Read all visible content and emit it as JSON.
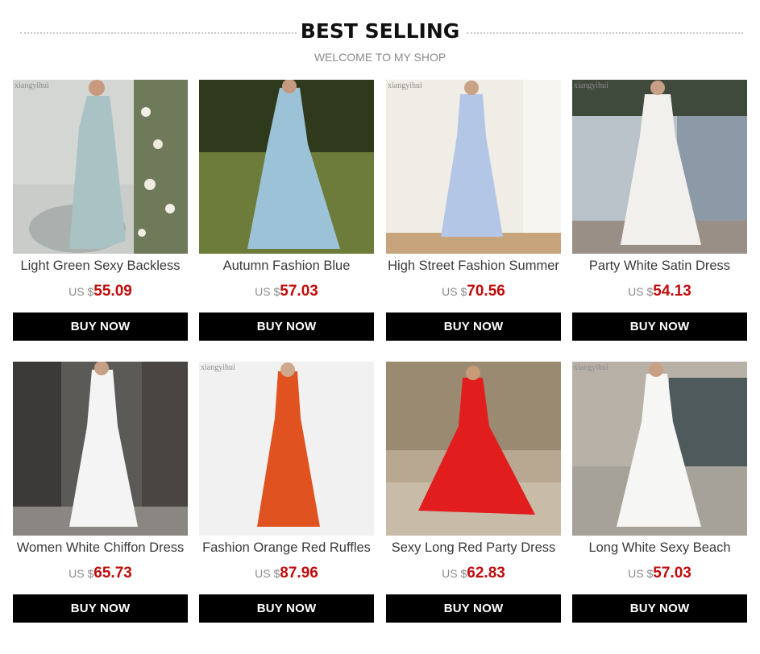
{
  "header": {
    "title": "BEST SELLING",
    "subtitle": "WELCOME TO MY SHOP"
  },
  "products": [
    {
      "name": "Light Green Sexy Backless",
      "currency": "US $",
      "price": "55.09",
      "button": "BUY NOW",
      "watermark": "xiangyihui"
    },
    {
      "name": "Autumn Fashion Blue",
      "currency": "US $",
      "price": "57.03",
      "button": "BUY NOW",
      "watermark": ""
    },
    {
      "name": "High Street Fashion Summer",
      "currency": "US $",
      "price": "70.56",
      "button": "BUY NOW",
      "watermark": "xiangyihui"
    },
    {
      "name": "Party White Satin Dress",
      "currency": "US $",
      "price": "54.13",
      "button": "BUY NOW",
      "watermark": "xiangyihui"
    },
    {
      "name": "Women White Chiffon Dress",
      "currency": "US $",
      "price": "65.73",
      "button": "BUY NOW",
      "watermark": ""
    },
    {
      "name": "Fashion Orange Red Ruffles",
      "currency": "US $",
      "price": "87.96",
      "button": "BUY NOW",
      "watermark": "xiangyihui"
    },
    {
      "name": "Sexy Long Red Party Dress",
      "currency": "US $",
      "price": "62.83",
      "button": "BUY NOW",
      "watermark": ""
    },
    {
      "name": "Long White Sexy Beach",
      "currency": "US $",
      "price": "57.03",
      "button": "BUY NOW",
      "watermark": "xiangyihui"
    }
  ],
  "colors": {
    "price_red": "#c00d0d",
    "button_bg": "#000000",
    "dress_colors": [
      "#a9c2c4",
      "#9cc2d8",
      "#b4c6e6",
      "#f2f0ec",
      "#f4f4f4",
      "#e0521f",
      "#e11d1d",
      "#f6f6f4"
    ]
  }
}
